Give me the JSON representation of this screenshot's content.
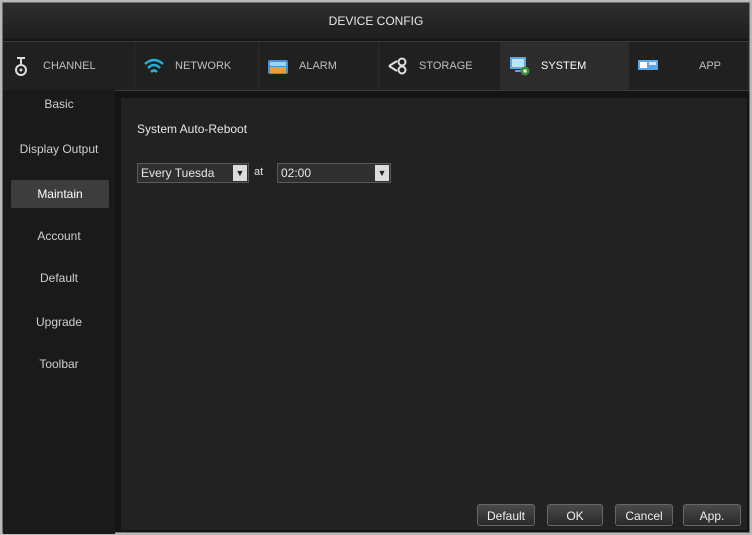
{
  "window": {
    "title": "DEVICE CONFIG"
  },
  "tabs": [
    {
      "label": "CHANNEL",
      "icon": "camera-icon"
    },
    {
      "label": "NETWORK",
      "icon": "wifi-icon"
    },
    {
      "label": "ALARM",
      "icon": "alarm-icon"
    },
    {
      "label": "STORAGE",
      "icon": "storage-icon"
    },
    {
      "label": "SYSTEM",
      "icon": "system-icon",
      "active": true
    },
    {
      "label": "APP",
      "icon": "app-icon"
    }
  ],
  "sidebar": {
    "items": [
      {
        "label": "Basic"
      },
      {
        "label": "Display Output"
      },
      {
        "label": "Maintain",
        "active": true
      },
      {
        "label": "Account"
      },
      {
        "label": "Default"
      },
      {
        "label": "Upgrade"
      },
      {
        "label": "Toolbar"
      }
    ]
  },
  "maintain": {
    "section_title": "System Auto-Reboot",
    "day_select": "Every Tuesda",
    "at_label": "at",
    "time_select": "02:00",
    "arrow_glyph": "▼"
  },
  "buttons": {
    "default": "Default",
    "ok": "OK",
    "cancel": "Cancel",
    "apply": "App."
  }
}
